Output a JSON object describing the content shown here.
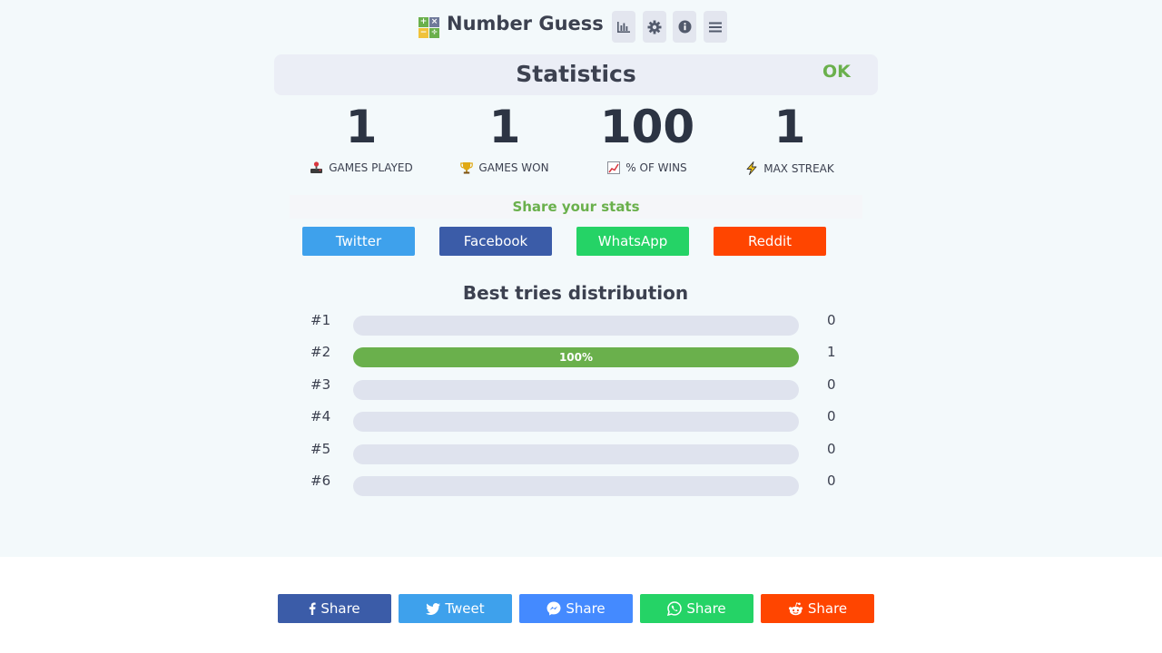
{
  "header": {
    "title": "Number Guess",
    "logo_symbols": [
      "+",
      "×",
      "−",
      "÷"
    ],
    "icons": [
      "bar-chart-icon",
      "gear-icon",
      "info-icon",
      "menu-icon"
    ]
  },
  "stats_dialog": {
    "title": "Statistics",
    "ok_label": "OK",
    "stats": [
      {
        "value": "1",
        "label": "GAMES PLAYED",
        "icon": "joystick-icon"
      },
      {
        "value": "1",
        "label": "GAMES WON",
        "icon": "trophy-icon"
      },
      {
        "value": "100",
        "label": "% OF WINS",
        "icon": "chart-icon"
      },
      {
        "value": "1",
        "label": "MAX STREAK",
        "icon": "lightning-icon"
      }
    ],
    "share_heading": "Share your stats",
    "share_buttons": [
      {
        "label": "Twitter",
        "color": "#3ea1ec"
      },
      {
        "label": "Facebook",
        "color": "#3b5ca8"
      },
      {
        "label": "WhatsApp",
        "color": "#25d366"
      },
      {
        "label": "Reddit",
        "color": "#ff4500"
      }
    ],
    "distribution_title": "Best tries distribution",
    "distribution": [
      {
        "label": "#1",
        "count": "0",
        "fraction": 0,
        "bar_text": ""
      },
      {
        "label": "#2",
        "count": "1",
        "fraction": 1,
        "bar_text": "100%"
      },
      {
        "label": "#3",
        "count": "0",
        "fraction": 0,
        "bar_text": ""
      },
      {
        "label": "#4",
        "count": "0",
        "fraction": 0,
        "bar_text": ""
      },
      {
        "label": "#5",
        "count": "0",
        "fraction": 0,
        "bar_text": ""
      },
      {
        "label": "#6",
        "count": "0",
        "fraction": 0,
        "bar_text": ""
      }
    ]
  },
  "footer_share": [
    {
      "label": "Share",
      "icon": "facebook-icon",
      "color": "#3b5998"
    },
    {
      "label": "Tweet",
      "icon": "twitter-icon",
      "color": "#3ea1ec"
    },
    {
      "label": "Share",
      "icon": "messenger-icon",
      "color": "#448aff"
    },
    {
      "label": "Share",
      "icon": "whatsapp-icon",
      "color": "#25d366"
    },
    {
      "label": "Share",
      "icon": "reddit-icon",
      "color": "#ff4500"
    }
  ]
}
